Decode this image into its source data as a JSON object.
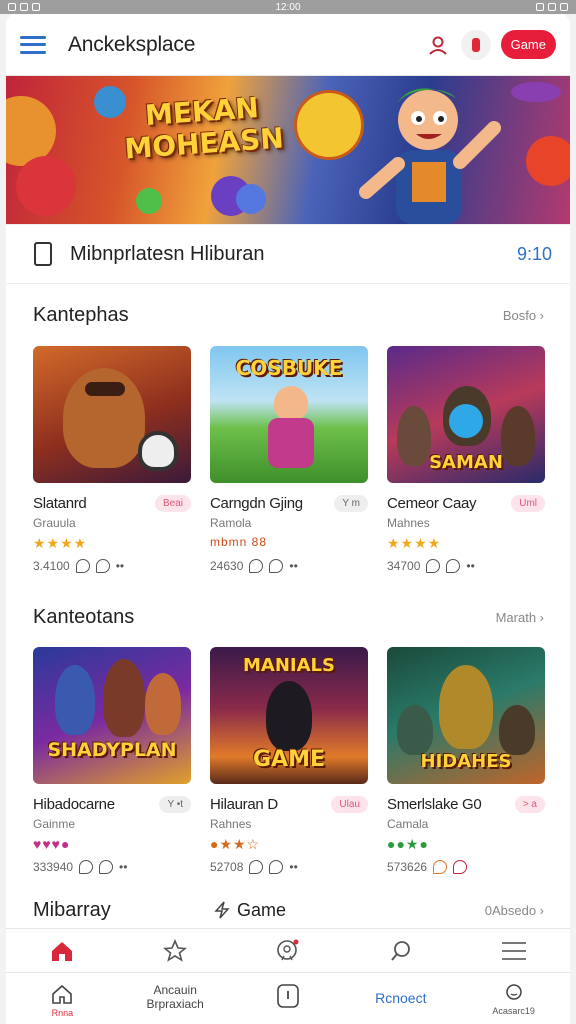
{
  "status": {
    "time": "12:00"
  },
  "topbar": {
    "title": "Anckeksplace",
    "game_button": "Game"
  },
  "banner": {
    "title": "MEKAN MOHEASN"
  },
  "hiburan": {
    "title": "Mibnprlatesn Hliburan",
    "value": "9:10"
  },
  "section1": {
    "title": "Kantephas",
    "link": "Bosfo ›",
    "cards": [
      {
        "name": "Slatanrd",
        "badge": "Beai",
        "sub": "Grauula",
        "stars": "★★★★",
        "meta": "3.4100",
        "thumb_label": ""
      },
      {
        "name": "Carngdn Gjing",
        "badge": "Y m",
        "sub": "Ramola",
        "stars": "mbmn 88",
        "meta": "24630",
        "thumb_label": "COSBUKE"
      },
      {
        "name": "Cemeor Caay",
        "badge": "Uml",
        "sub": "Mahnes",
        "stars": "★★★★",
        "meta": "34700",
        "thumb_label": "SAMAN"
      }
    ]
  },
  "section2": {
    "title": "Kanteotans",
    "link": "Marath ›",
    "cards": [
      {
        "name": "Hibadocarne",
        "badge": "Y •t",
        "sub": "Gainme",
        "stars": "♥♥♥●",
        "meta": "333940",
        "thumb_label": "SHADYPLAN"
      },
      {
        "name": "Hilauran D",
        "badge": "Ulau",
        "sub": "Rahnes",
        "stars": "●★★☆",
        "meta": "52708",
        "thumb_label": "GAME"
      },
      {
        "name": "Smerlslake G0",
        "badge": "> a",
        "sub": "Camala",
        "stars": "●●★●",
        "meta": "573626",
        "thumb_label": "HIDAHES"
      }
    ]
  },
  "mini": {
    "title": "Mibarray",
    "mid": "Game",
    "right": "0Absedo ›"
  },
  "navbar": {
    "home_label": "Rnna",
    "item2": "Ancauin Brpraxiach",
    "item4": "Rcnoect",
    "item5": "Acasarc19"
  },
  "colors": {
    "accent": "#e61e3c",
    "link_blue": "#2f6fc6"
  }
}
